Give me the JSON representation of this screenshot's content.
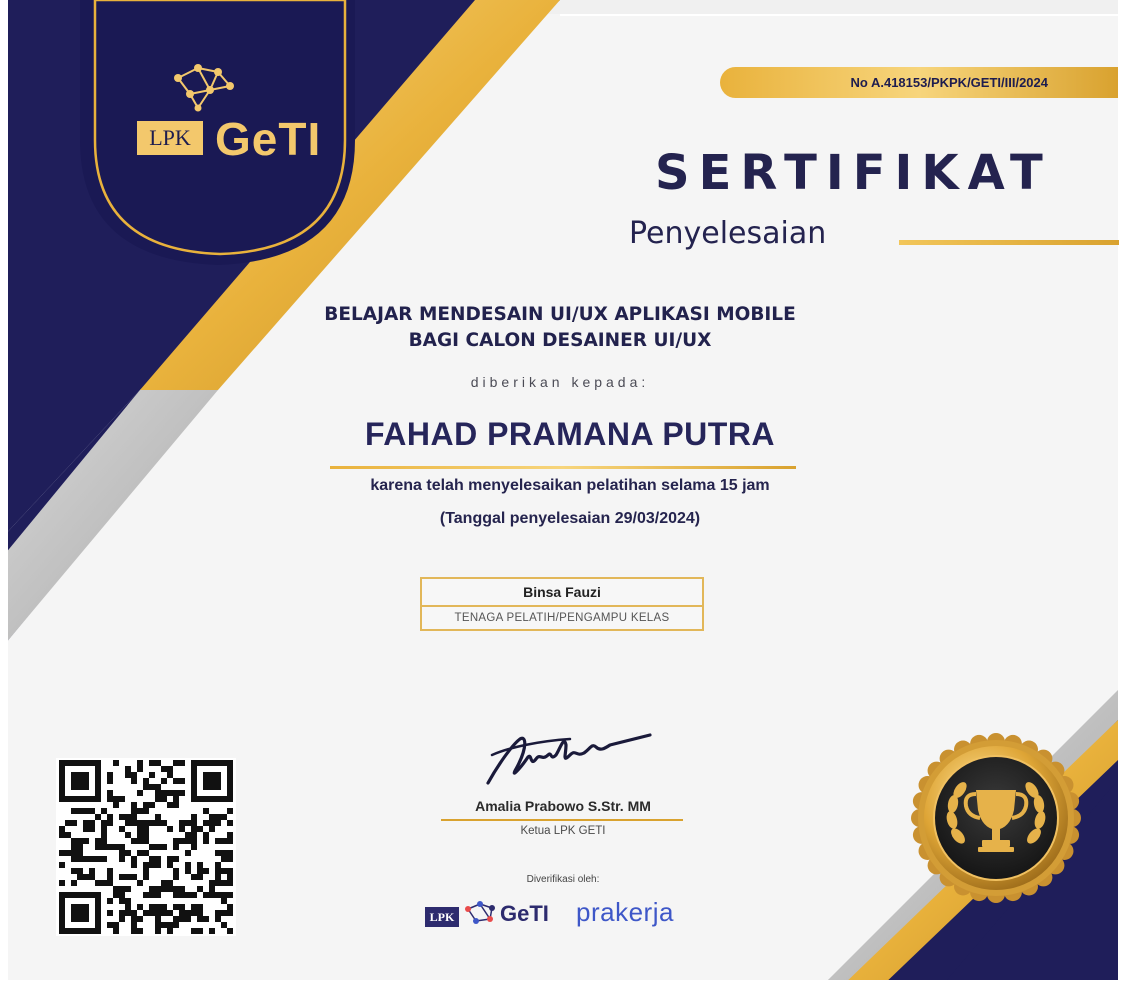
{
  "certificate": {
    "number": "No A.418153/PKPK/GETI/III/2024",
    "title": "SERTIFIKAT",
    "subtitle": "Penyelesaian",
    "course_line1": "BELAJAR MENDESAIN UI/UX APLIKASI MOBILE",
    "course_line2": "BAGI CALON DESAINER UI/UX",
    "given_to": "diberikan kepada:",
    "recipient": "FAHAD PRAMANA PUTRA",
    "reason": "karena telah menyelesaikan pelatihan selama 15 jam",
    "completion_date": "(Tanggal penyelesaian 29/03/2024)"
  },
  "trainer": {
    "name": "Binsa Fauzi",
    "role": "TENAGA PELATIH/PENGAMPU KELAS"
  },
  "signatory": {
    "name": "Amalia Prabowo S.Str. MM",
    "role": "Ketua LPK GETI"
  },
  "verification": {
    "label": "Diverifikasi oleh:",
    "logo1_lpk": "LPK",
    "logo1_geti": "GeTI",
    "logo2": "prakerja"
  },
  "header_logo": {
    "lpk": "LPK",
    "geti": "GeTI"
  },
  "colors": {
    "navy": "#1f1e5a",
    "gold": "#e9b23c",
    "gold_light": "#f7d57c",
    "silver": "#c9c9c9"
  },
  "icons": {
    "network": "network-nodes-icon",
    "trophy": "trophy-icon",
    "laurel": "laurel-wreath-icon",
    "qr": "qr-code"
  }
}
